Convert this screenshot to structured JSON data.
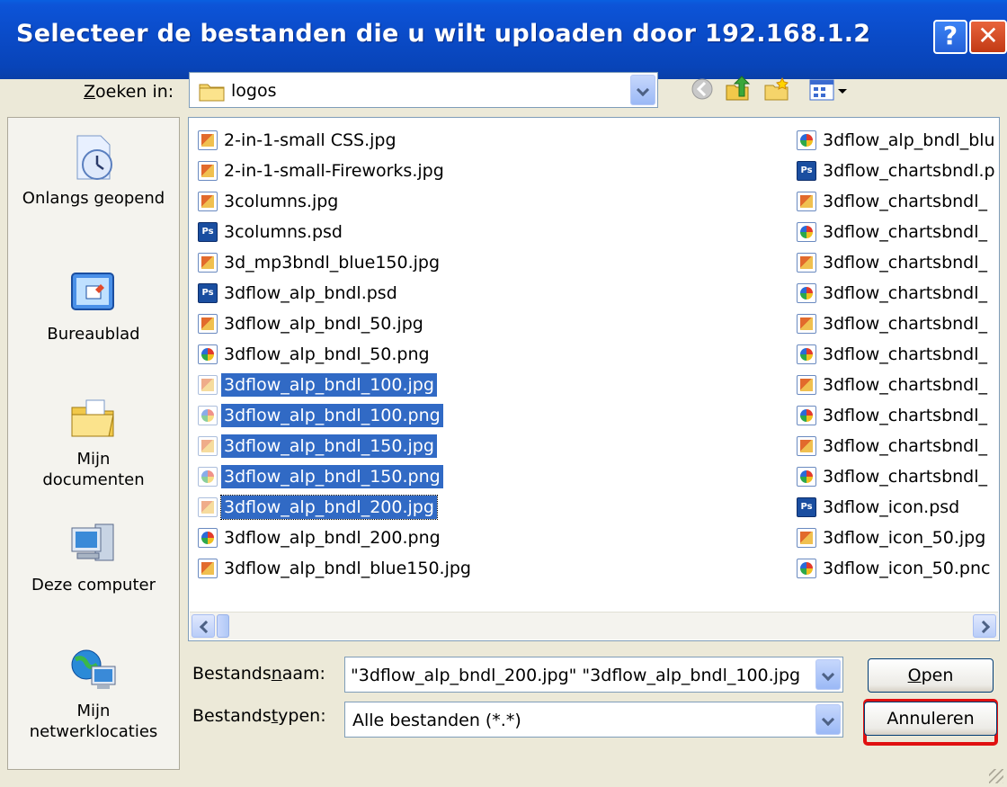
{
  "window": {
    "title": "Selecteer de bestanden die u wilt uploaden door 192.168.1.2",
    "help_glyph": "?",
    "close_glyph": "✕"
  },
  "lookin": {
    "label_prefix": "Z",
    "label_rest": "oeken in:",
    "value": "logos"
  },
  "places": [
    {
      "label": "Onlangs geopend",
      "icon": "recent-clock-icon"
    },
    {
      "label": "Bureaublad",
      "icon": "desktop-icon"
    },
    {
      "label": "Mijn documenten",
      "icon": "folder-documents-icon"
    },
    {
      "label": "Deze computer",
      "icon": "computer-icon"
    },
    {
      "label": "Mijn netwerklocaties",
      "icon": "network-globe-icon"
    }
  ],
  "files_col1": [
    {
      "name": "2-in-1-small CSS.jpg",
      "type": "jpg"
    },
    {
      "name": "2-in-1-small-Fireworks.jpg",
      "type": "jpg"
    },
    {
      "name": "3columns.jpg",
      "type": "jpg"
    },
    {
      "name": "3columns.psd",
      "type": "psd"
    },
    {
      "name": "3d_mp3bndl_blue150.jpg",
      "type": "jpg"
    },
    {
      "name": "3dflow_alp_bndl.psd",
      "type": "psd"
    },
    {
      "name": "3dflow_alp_bndl_50.jpg",
      "type": "jpg"
    },
    {
      "name": "3dflow_alp_bndl_50.png",
      "type": "png"
    },
    {
      "name": "3dflow_alp_bndl_100.jpg",
      "type": "jpg",
      "selected": true
    },
    {
      "name": "3dflow_alp_bndl_100.png",
      "type": "png",
      "selected": true
    },
    {
      "name": "3dflow_alp_bndl_150.jpg",
      "type": "jpg",
      "selected": true
    },
    {
      "name": "3dflow_alp_bndl_150.png",
      "type": "png",
      "selected": true
    },
    {
      "name": "3dflow_alp_bndl_200.jpg",
      "type": "jpg",
      "selected": true,
      "focused": true
    },
    {
      "name": "3dflow_alp_bndl_200.png",
      "type": "png"
    },
    {
      "name": "3dflow_alp_bndl_blue150.jpg",
      "type": "jpg"
    }
  ],
  "files_col2": [
    {
      "name": "3dflow_alp_bndl_blu",
      "type": "png"
    },
    {
      "name": "3dflow_chartsbndl.p",
      "type": "psd"
    },
    {
      "name": "3dflow_chartsbndl_",
      "type": "jpg"
    },
    {
      "name": "3dflow_chartsbndl_",
      "type": "png"
    },
    {
      "name": "3dflow_chartsbndl_",
      "type": "jpg"
    },
    {
      "name": "3dflow_chartsbndl_",
      "type": "png"
    },
    {
      "name": "3dflow_chartsbndl_",
      "type": "jpg"
    },
    {
      "name": "3dflow_chartsbndl_",
      "type": "png"
    },
    {
      "name": "3dflow_chartsbndl_",
      "type": "jpg"
    },
    {
      "name": "3dflow_chartsbndl_",
      "type": "png"
    },
    {
      "name": "3dflow_chartsbndl_",
      "type": "jpg"
    },
    {
      "name": "3dflow_chartsbndl_",
      "type": "png"
    },
    {
      "name": "3dflow_icon.psd",
      "type": "psd"
    },
    {
      "name": "3dflow_icon_50.jpg",
      "type": "jpg"
    },
    {
      "name": "3dflow_icon_50.pnc",
      "type": "png"
    }
  ],
  "filename": {
    "label_prefix": "Bestands",
    "label_underlined": "n",
    "label_rest": "aam:",
    "value": "\"3dflow_alp_bndl_200.jpg\" \"3dflow_alp_bndl_100.jpg"
  },
  "filetype": {
    "label_prefix": "Bestands",
    "label_underlined": "t",
    "label_rest": "ypen:",
    "value": "Alle bestanden (*.*)"
  },
  "buttons": {
    "open_underlined": "O",
    "open_rest": "pen",
    "cancel": "Annuleren"
  },
  "psd_glyph": "Ps"
}
